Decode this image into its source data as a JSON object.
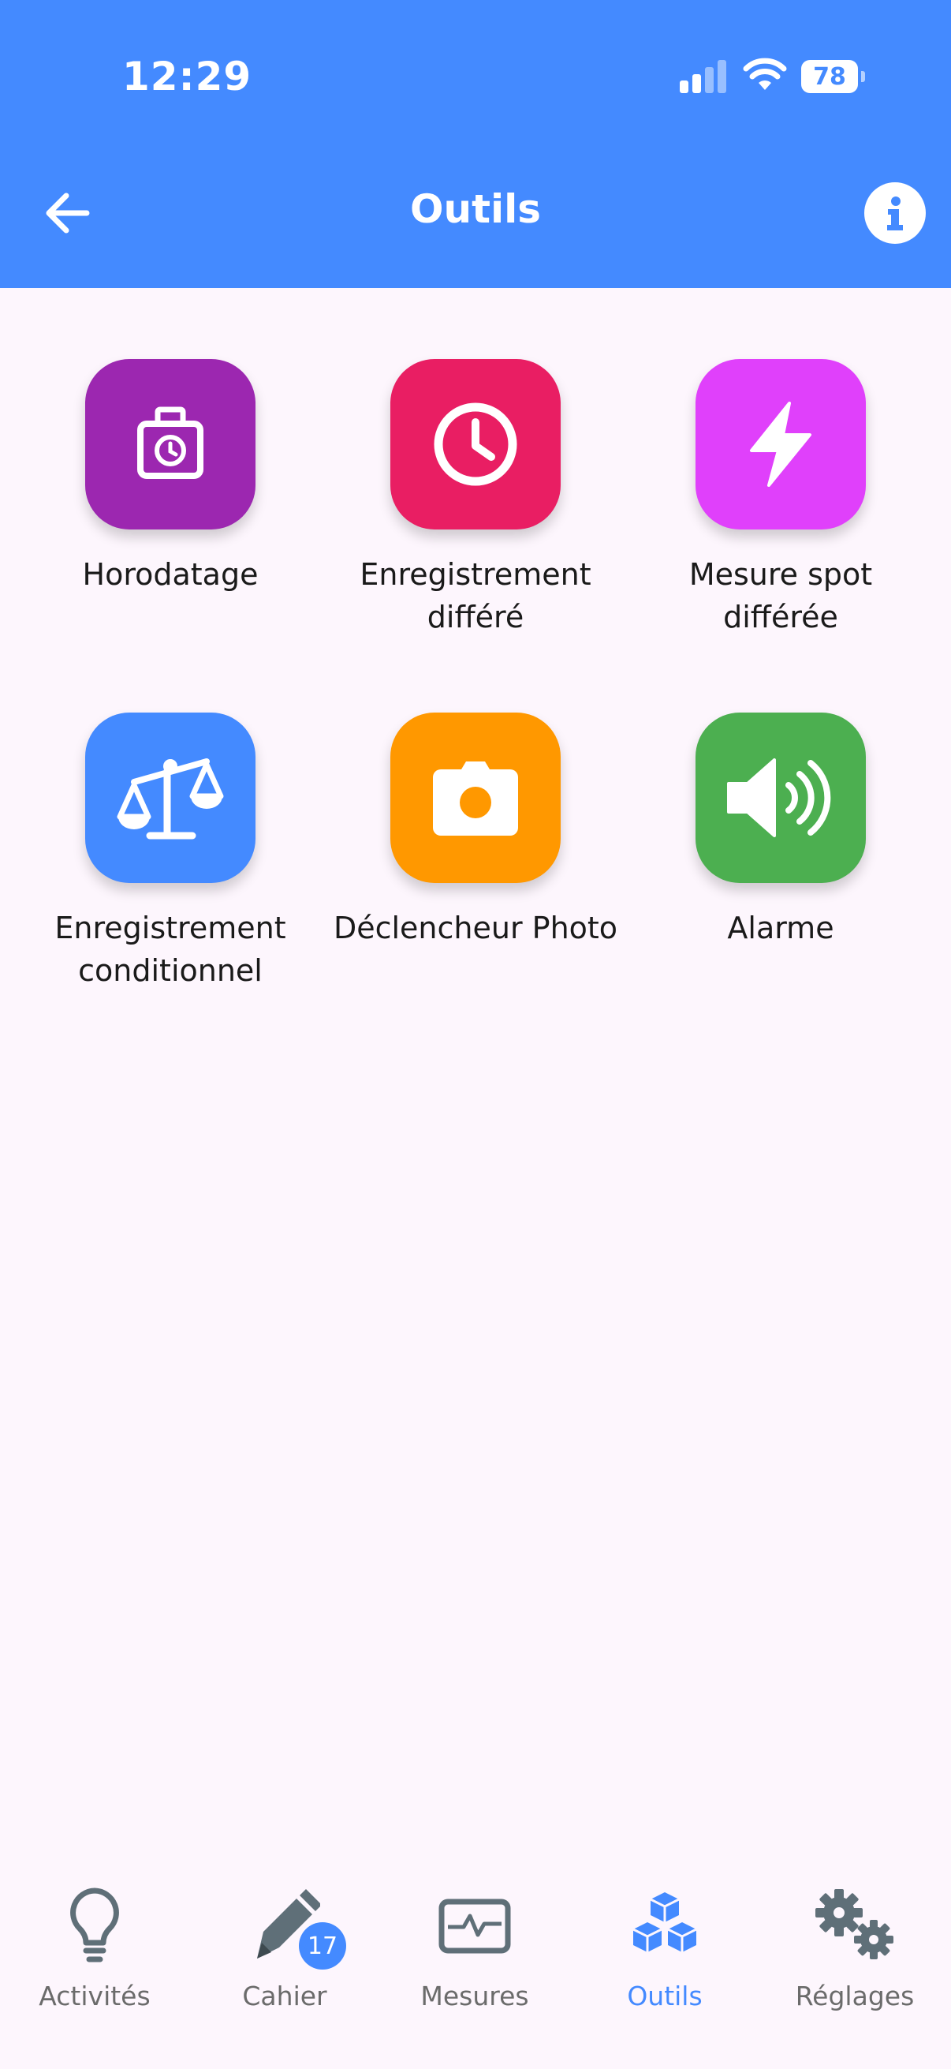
{
  "status_bar": {
    "time": "12:29",
    "battery": "78"
  },
  "header": {
    "title": "Outils"
  },
  "colors": {
    "accent": "#448aff",
    "horodatage": "#9c27b0",
    "enregistrement_differe": "#e91e63",
    "mesure_spot": "#e040fb",
    "enregistrement_conditionnel": "#448aff",
    "declencheur_photo": "#ff9800",
    "alarme": "#4caf50"
  },
  "tools": [
    {
      "label": "Horodatage",
      "icon": "timestamp-icon"
    },
    {
      "label": "Enregistrement\ndifféré",
      "icon": "clock-icon"
    },
    {
      "label": "Mesure spot\ndifférée",
      "icon": "lightning-icon"
    },
    {
      "label": "Enregistrement\nconditionnel",
      "icon": "scale-icon"
    },
    {
      "label": "Déclencheur Photo",
      "icon": "camera-icon"
    },
    {
      "label": "Alarme",
      "icon": "speaker-icon"
    }
  ],
  "nav": {
    "activites": "Activités",
    "cahier": "Cahier",
    "cahier_badge": "17",
    "mesures": "Mesures",
    "outils": "Outils",
    "reglages": "Réglages",
    "active": "Outils"
  }
}
